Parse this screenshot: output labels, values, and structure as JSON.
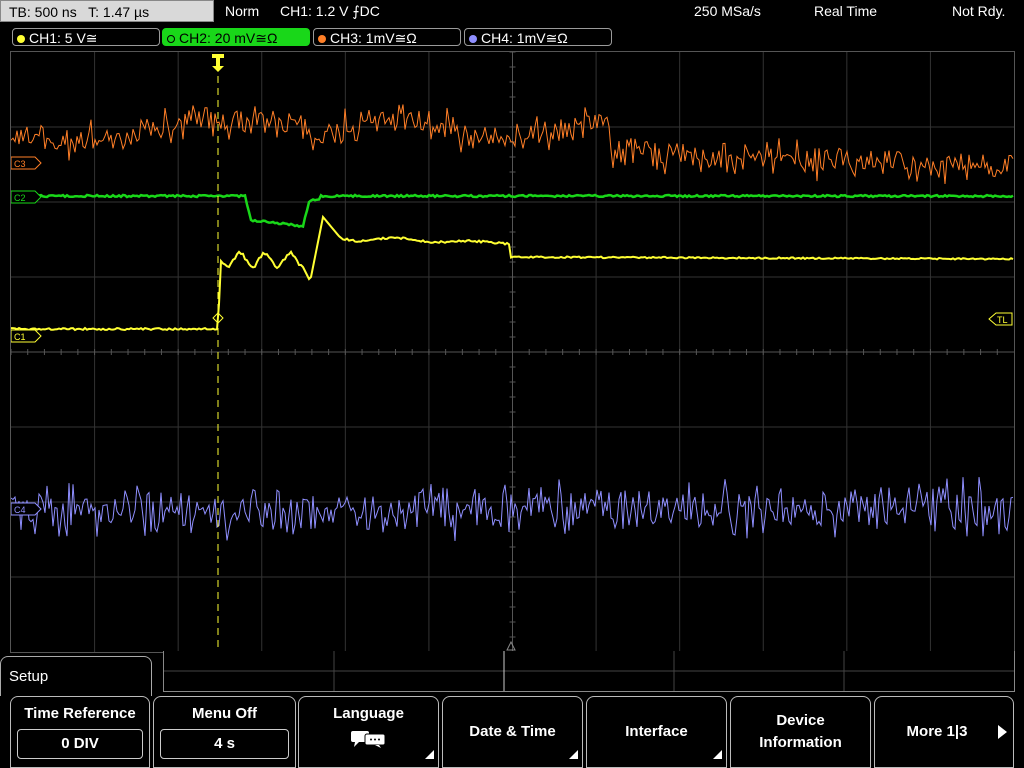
{
  "status_bar": {
    "timebase": "TB: 500 ns",
    "trigger_time": "T: 1.47 µs",
    "mode": "Norm",
    "trigger": "CH1: 1.2 V ⨍DC",
    "sample_rate": "250 MSa/s",
    "acq_mode": "Real Time",
    "state": "Not Rdy."
  },
  "channels": [
    {
      "label": "CH1: 5 V≅",
      "color": "#ffff33",
      "active": false
    },
    {
      "label": "CH2: 20 mV≅Ω",
      "color": "#19d719",
      "active": true
    },
    {
      "label": "CH3: 1mV≅Ω",
      "color": "#ff7f27",
      "active": false
    },
    {
      "label": "CH4: 1mV≅Ω",
      "color": "#8f8fff",
      "active": false
    }
  ],
  "markers": {
    "c3": "C3",
    "c2": "C2",
    "c1": "C1",
    "c4": "C4",
    "trigger_level": "TL"
  },
  "menu": {
    "title": "Setup",
    "time_reference": {
      "label": "Time Reference",
      "value": "0 DIV"
    },
    "menu_off": {
      "label": "Menu Off",
      "value": "4 s"
    },
    "language": {
      "label": "Language"
    },
    "date_time": {
      "label": "Date & Time"
    },
    "interface": {
      "label": "Interface"
    },
    "device_info": {
      "line1": "Device",
      "line2": "Information"
    },
    "more": {
      "label": "More 1|3"
    }
  },
  "icons": {
    "language": "speech-bubble-icon",
    "more": "arrow-right-icon",
    "trigger_position": "trigger-t-marker-icon"
  },
  "colors": {
    "ch1": "#ffff33",
    "ch2": "#19d719",
    "ch3": "#ff7f27",
    "ch4": "#8f8fff",
    "grid": "#3c3c3c"
  }
}
